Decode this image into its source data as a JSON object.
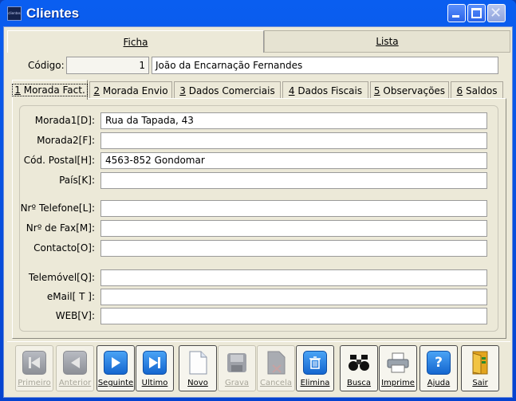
{
  "window": {
    "title": "Clientes",
    "app_icon_text": "clientes"
  },
  "main_tabs": [
    {
      "label": "Ficha"
    },
    {
      "label": "Lista"
    }
  ],
  "code": {
    "label": "Código:",
    "value": "1",
    "name": "João da Encarnação Fernandes"
  },
  "sub_tabs": [
    {
      "num": "1",
      "label": "Morada Fact."
    },
    {
      "num": "2",
      "label": "Morada Envio"
    },
    {
      "num": "3",
      "label": "Dados Comerciais"
    },
    {
      "num": "4",
      "label": "Dados Fiscais"
    },
    {
      "num": "5",
      "label": "Observações"
    },
    {
      "num": "6",
      "label": "Saldos"
    }
  ],
  "fields": [
    {
      "label": "Morada1[D]:",
      "value": "Rua da Tapada, 43"
    },
    {
      "label": "Morada2[F]:",
      "value": ""
    },
    {
      "label": "Cód. Postal[H]:",
      "value": "4563-852 Gondomar"
    },
    {
      "label": "País[K]:",
      "value": ""
    },
    {
      "label": "Nrº Telefone[L]:",
      "value": ""
    },
    {
      "label": "Nrº de Fax[M]:",
      "value": ""
    },
    {
      "label": "Contacto[O]:",
      "value": ""
    },
    {
      "label": "Telemóvel[Q]:",
      "value": ""
    },
    {
      "label": "eMail[ T ]:",
      "value": ""
    },
    {
      "label": "WEB[V]:",
      "value": ""
    }
  ],
  "toolbar": [
    {
      "label": "Primeiro",
      "icon": "first-icon",
      "enabled": false
    },
    {
      "label": "Anterior",
      "icon": "previous-icon",
      "enabled": false
    },
    {
      "label": "Seguinte",
      "icon": "next-icon",
      "enabled": true
    },
    {
      "label": "Ultimo",
      "icon": "last-icon",
      "enabled": true
    },
    {
      "label": "Novo",
      "icon": "new-document-icon",
      "enabled": true
    },
    {
      "label": "Grava",
      "icon": "save-disk-icon",
      "enabled": false
    },
    {
      "label": "Cancela",
      "icon": "cancel-document-icon",
      "enabled": false
    },
    {
      "label": "Elimina",
      "icon": "trash-icon",
      "enabled": true
    },
    {
      "label": "Busca",
      "icon": "binoculars-icon",
      "enabled": true
    },
    {
      "label": "Imprime",
      "icon": "printer-icon",
      "enabled": true
    },
    {
      "label": "Ajuda",
      "icon": "help-icon",
      "enabled": true
    },
    {
      "label": "Sair",
      "icon": "exit-door-icon",
      "enabled": true
    }
  ]
}
